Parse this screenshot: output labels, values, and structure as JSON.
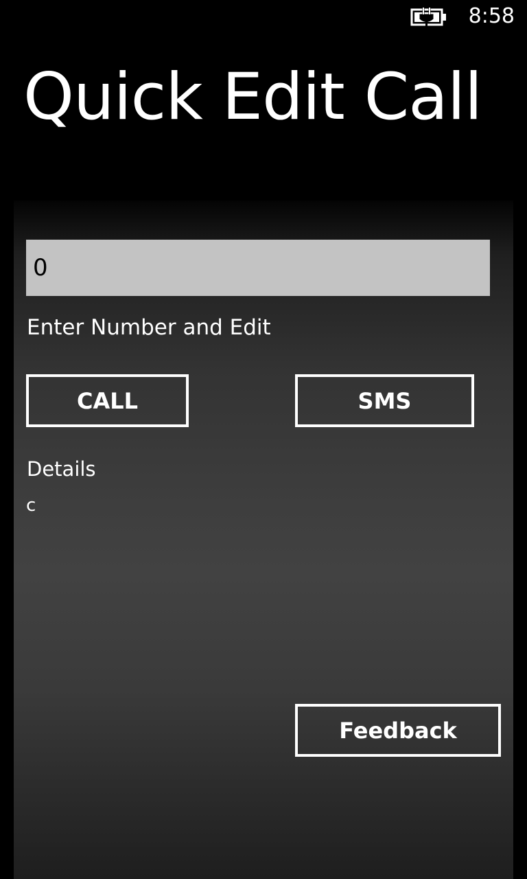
{
  "status_bar": {
    "time": "8:58",
    "battery_icon": "battery-charging-icon"
  },
  "page": {
    "title": "Quick Edit Call"
  },
  "form": {
    "number_value": "0",
    "hint": "Enter Number and Edit"
  },
  "buttons": {
    "call_label": "CALL",
    "sms_label": "SMS",
    "feedback_label": "Feedback"
  },
  "details": {
    "label": "Details",
    "value": "c"
  },
  "colors": {
    "background": "#000000",
    "input_background": "#c3c3c3",
    "foreground": "#ffffff"
  }
}
